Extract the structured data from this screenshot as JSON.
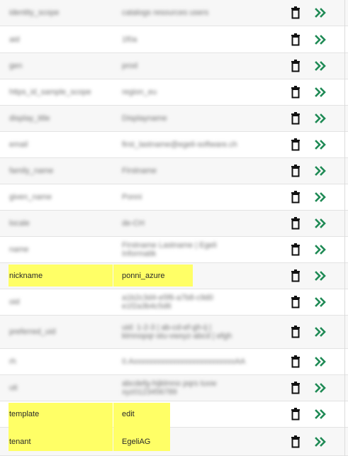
{
  "rows": [
    {
      "key": "identity_scope",
      "value": "catalogs resources users",
      "blur": true
    },
    {
      "key": "aid",
      "value": "1f0a",
      "blur": true
    },
    {
      "key": "gen",
      "value": "prod",
      "blur": true
    },
    {
      "key": "https_id_sample_scope",
      "value": "region_eu",
      "blur": true
    },
    {
      "key": "display_title",
      "value": "Displayname",
      "blur": true
    },
    {
      "key": "email",
      "value": "first_lastname@egeli-software.ch",
      "blur": true
    },
    {
      "key": "family_name",
      "value": "Firstname",
      "blur": true
    },
    {
      "key": "given_name",
      "value": "Ponni",
      "blur": true
    },
    {
      "key": "locale",
      "value": "de-CH",
      "blur": true
    },
    {
      "key": "name",
      "value": "Firstname Lastname | Egeli Informatik",
      "blur": true
    },
    {
      "key": "nickname",
      "value": "ponni_azure",
      "blur": false
    },
    {
      "key": "oid",
      "value": "a1b2c3d4-e5f6-a7b8-c9d0 e1f2a3b4c5d6",
      "blur": true
    },
    {
      "key": "preferred_uid",
      "value": "uid: 1-2-3 | ab-cd-ef-gh-ij | klmnopqr-stu-vwxyz-abcd | efgh",
      "blur": true
    },
    {
      "key": "rh",
      "value": "0.AxxxxxxxxxxxxxxxxxxxxxxxxxxAA",
      "blur": true
    },
    {
      "key": "uti",
      "value": "abcdefg-hijklmno pqrs tuvw xyz0123456789",
      "blur": true
    },
    {
      "key": "template",
      "value": "edit",
      "blur": false
    },
    {
      "key": "tenant",
      "value": "EgeliAG",
      "blur": false
    }
  ],
  "icons": {
    "delete": "trash-icon",
    "go": "double-chevron-right-icon"
  },
  "colors": {
    "highlight": "#ffff66",
    "chevron": "#1f8a55",
    "trash": "#111111"
  }
}
